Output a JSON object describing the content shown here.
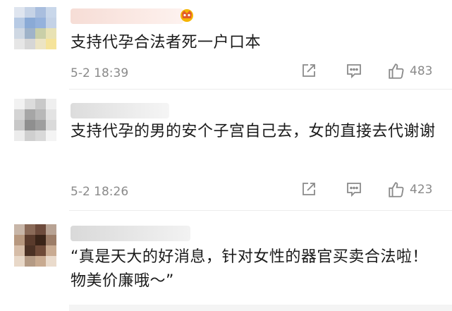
{
  "comments": [
    {
      "text": "支持代孕合法者死一户口本",
      "date": "5-2 18:39",
      "likes": "483",
      "avatar_colors": [
        "#dfe5ef",
        "#c6d3e6",
        "#a9bede",
        "#c9d7ea",
        "#b7cae4",
        "#8aaad6",
        "#95b2dc",
        "#c4d2e6",
        "#cfd8e3",
        "#9fb3c9",
        "#c9cfa8",
        "#e8e2b4",
        "#e6e6e6",
        "#d6d6d6",
        "#ece4c4",
        "#f5e39a"
      ]
    },
    {
      "text": "支持代孕的男的安个子宫自己去，女的直接去代谢谢",
      "date": "5-2 18:26",
      "likes": "423",
      "avatar_colors": [
        "#f2f2f2",
        "#dcdcdc",
        "#c9c9c9",
        "#efefef",
        "#d4d4d4",
        "#a6a6a6",
        "#b8b8b8",
        "#e3e3e3",
        "#c8c8c8",
        "#8f8f8f",
        "#9e9e9e",
        "#dadada",
        "#ececec",
        "#cfcfcf",
        "#d9d9d9",
        "#f4f4f4"
      ]
    },
    {
      "text": "“真是天大的好消息，针对女性的器官买卖合法啦！物美价廉哦～”",
      "avatar_colors": [
        "#c8b6a8",
        "#8a6a58",
        "#6d4b3c",
        "#b8a394",
        "#b7987f",
        "#5a3b2c",
        "#3a2418",
        "#9c7d68",
        "#d6bda8",
        "#4b3124",
        "#6e4a38",
        "#c9ab92",
        "#e8d8c8",
        "#b49a84",
        "#c8aa90",
        "#eadbcc"
      ]
    }
  ],
  "colors": {
    "meta": "#8a8a8a",
    "text": "#1a1a1a",
    "divider": "#ececec"
  },
  "icons": {
    "share": "share-icon",
    "reply": "comment-icon",
    "like": "thumb-up-icon",
    "badge": "crown-badge-icon"
  }
}
